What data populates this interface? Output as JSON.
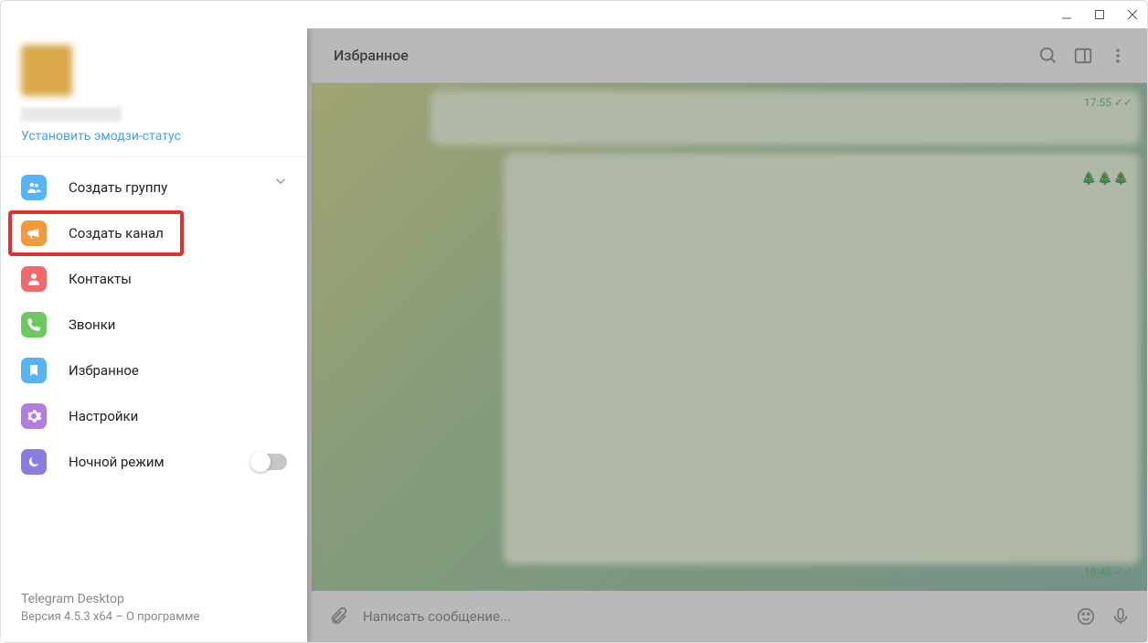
{
  "titlebar": {
    "minimize": "–",
    "maximize": "☐",
    "close": "✕"
  },
  "menu": {
    "emoji_status": "Установить эмодзи-статус",
    "items": [
      {
        "label": "Создать группу",
        "icon": "group"
      },
      {
        "label": "Создать канал",
        "icon": "channel"
      },
      {
        "label": "Контакты",
        "icon": "contacts"
      },
      {
        "label": "Звонки",
        "icon": "calls"
      },
      {
        "label": "Избранное",
        "icon": "saved"
      },
      {
        "label": "Настройки",
        "icon": "settings"
      },
      {
        "label": "Ночной режим",
        "icon": "night"
      }
    ],
    "footer_title": "Telegram Desktop",
    "footer_version": "Версия 4.5.3 x64 – О программе"
  },
  "chat": {
    "title": "Избранное",
    "times": {
      "top": "17:55",
      "bottom": "16:40"
    },
    "input_placeholder": "Написать сообщение...",
    "trees": "🎄🎄🎄"
  }
}
